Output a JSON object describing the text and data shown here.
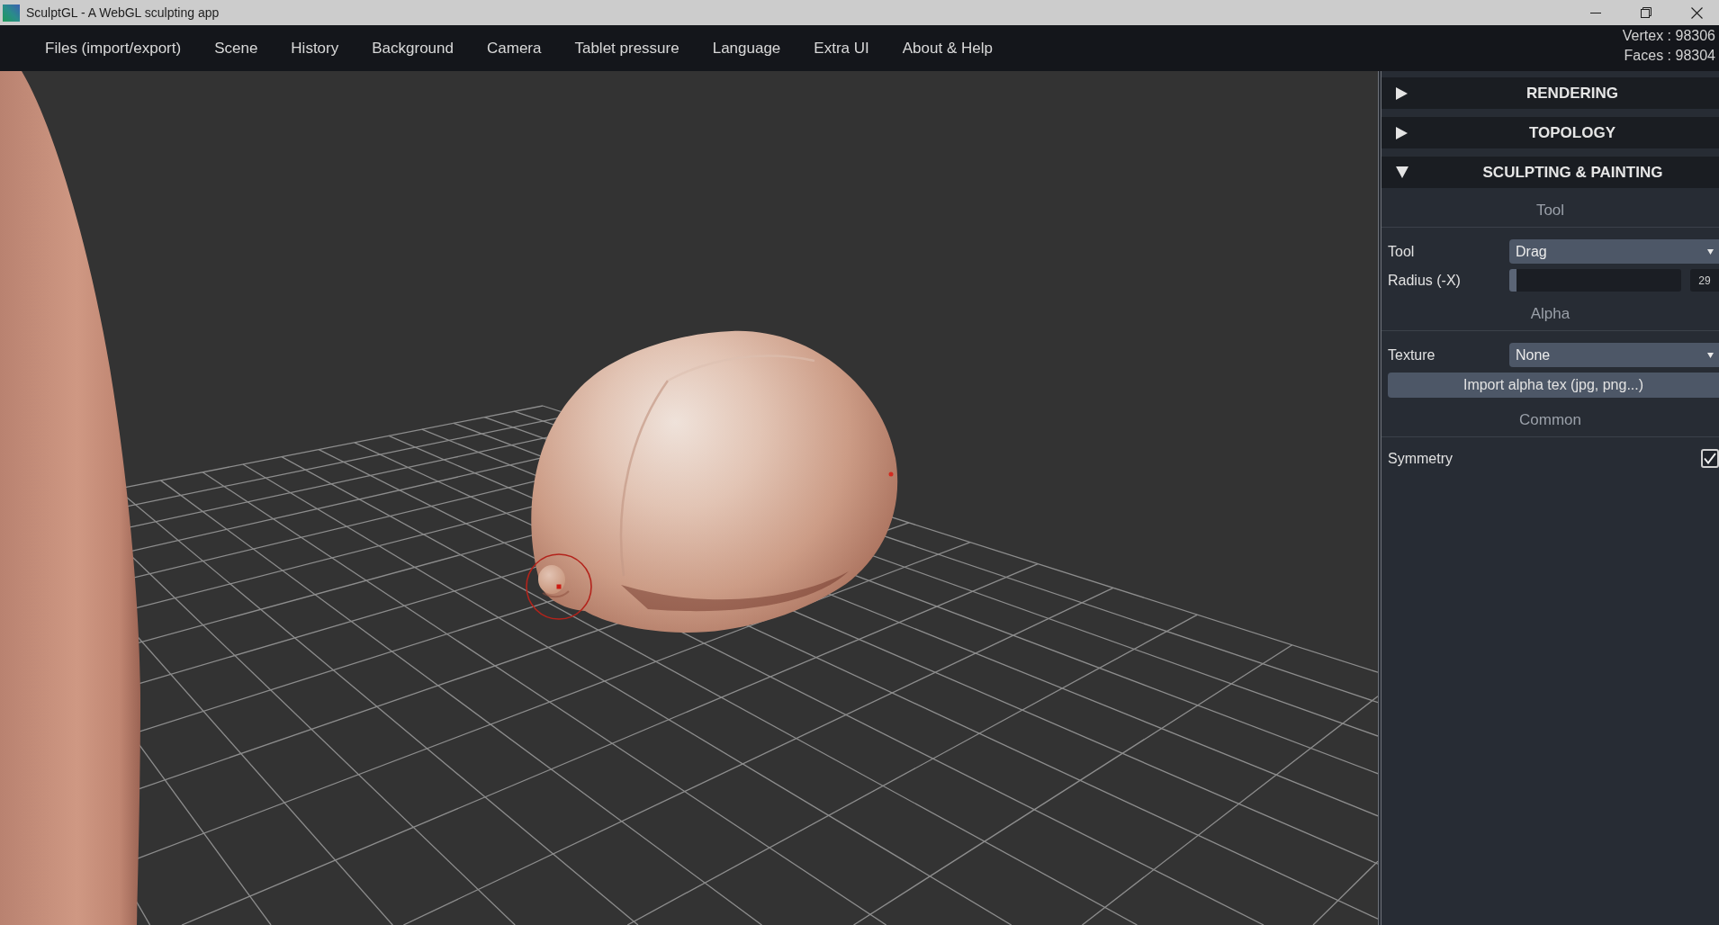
{
  "window": {
    "title": "SculptGL - A WebGL sculpting app"
  },
  "menu": [
    "Files (import/export)",
    "Scene",
    "History",
    "Background",
    "Camera",
    "Tablet pressure",
    "Language",
    "Extra UI",
    "About & Help"
  ],
  "stats": [
    "Vertex : 98306",
    "Faces : 98304"
  ],
  "panel": {
    "folders": [
      {
        "title": "RENDERING",
        "expanded": false
      },
      {
        "title": "TOPOLOGY",
        "expanded": false
      },
      {
        "title": "SCULPTING & PAINTING",
        "expanded": true,
        "sections": [
          {
            "title": "Tool",
            "controls": [
              {
                "kind": "select",
                "label": "Tool",
                "value": "Drag"
              },
              {
                "kind": "slider",
                "label": "Radius (-X)",
                "level": 0.04,
                "reading": "29"
              }
            ]
          },
          {
            "title": "Alpha",
            "controls": [
              {
                "kind": "select",
                "label": "Texture",
                "value": "None"
              },
              {
                "kind": "button",
                "label": "Import alpha tex (jpg, png...)"
              }
            ]
          },
          {
            "title": "Common",
            "controls": [
              {
                "kind": "checkbox",
                "label": "Symmetry",
                "checked": true
              }
            ]
          }
        ]
      }
    ]
  }
}
